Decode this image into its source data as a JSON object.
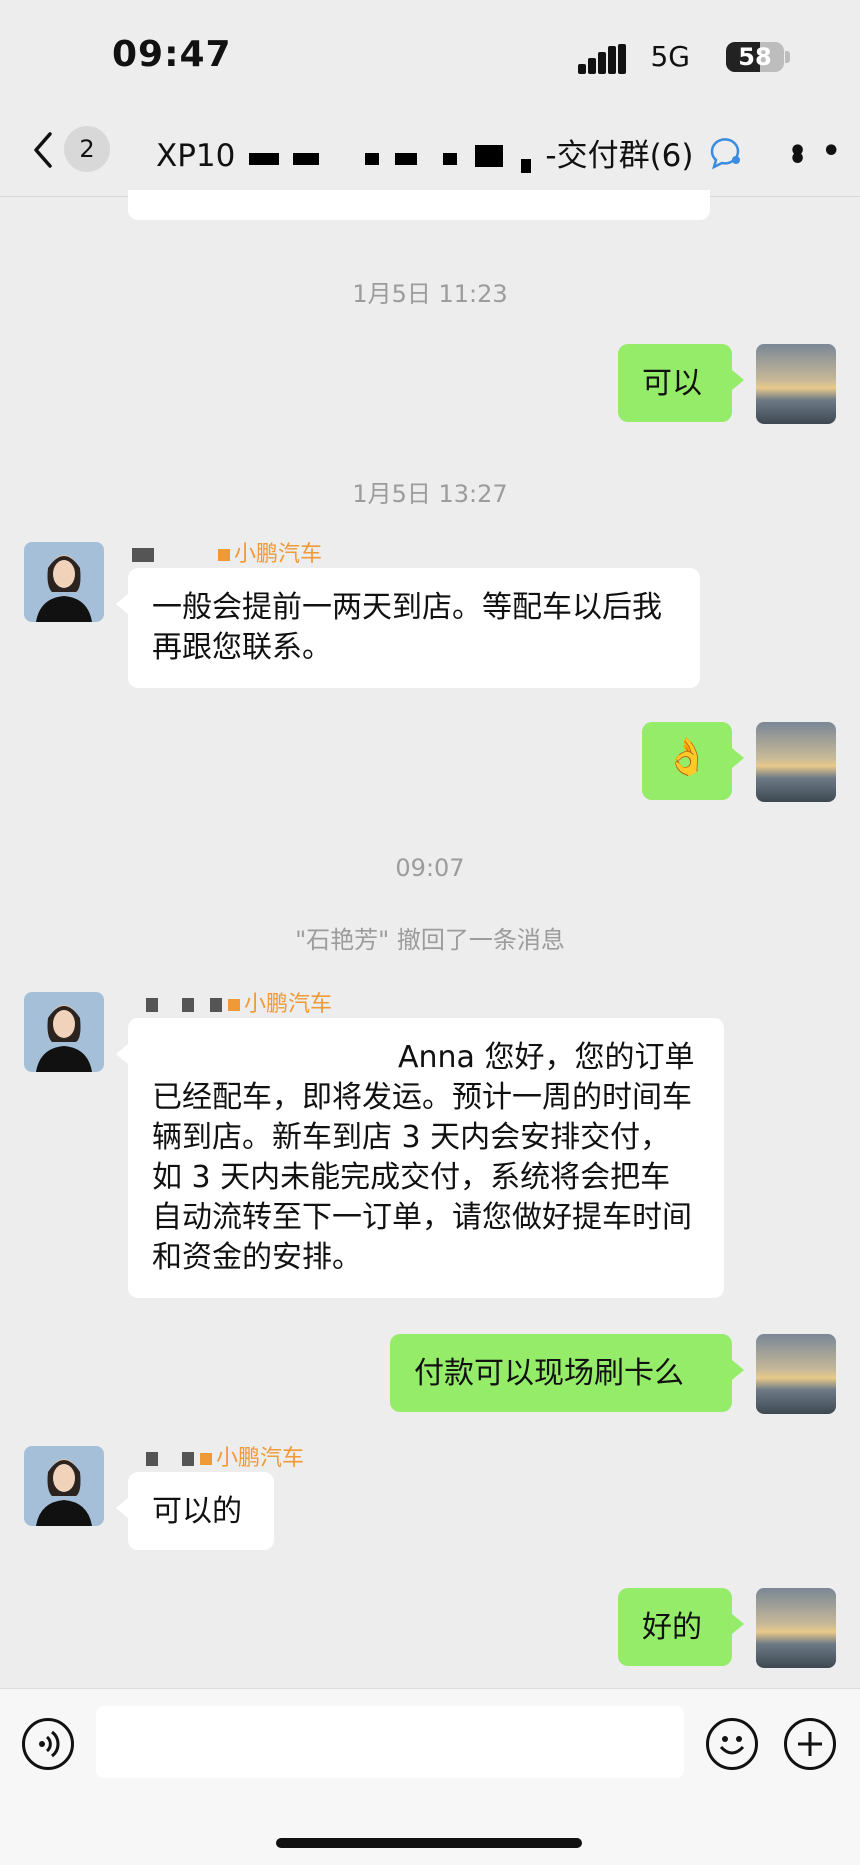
{
  "status": {
    "time": "09:47",
    "network": "5G",
    "battery": "58",
    "battery_fraction": 0.58
  },
  "header": {
    "unread_count": "2",
    "title_prefix": "XP10",
    "title_suffix": "-交付群(6)"
  },
  "messages": {
    "t1": "1月5日 11:23",
    "m1": "可以",
    "t2": "1月5日 13:27",
    "sender_tag": "小鹏汽车",
    "m2": "一般会提前一两天到店。等配车以后我再跟您联系。",
    "m3_emoji": "👌",
    "t3": "09:07",
    "recall_notice": "\"石艳芳\" 撤回了一条消息",
    "m4_name": "Anna",
    "m4_text": "您好，您的订单已经配车，即将发运。预计一周的时间车辆到店。新车到店 3 天内会安排交付，如 3 天内未能完成交付，系统将会把车自动流转至下一订单，请您做好提车时间和资金的安排。",
    "m5": "付款可以现场刷卡么",
    "m6": "可以的",
    "m7": "好的"
  },
  "colors": {
    "background": "#ededed",
    "sent_bubble": "#95ec69",
    "sender_tag": "#f09a37",
    "timestamp": "#9c9c9c"
  },
  "icons": [
    "back-chevron-icon",
    "group-chat-icon",
    "more-icon",
    "voice-icon",
    "emoji-icon",
    "add-icon"
  ]
}
